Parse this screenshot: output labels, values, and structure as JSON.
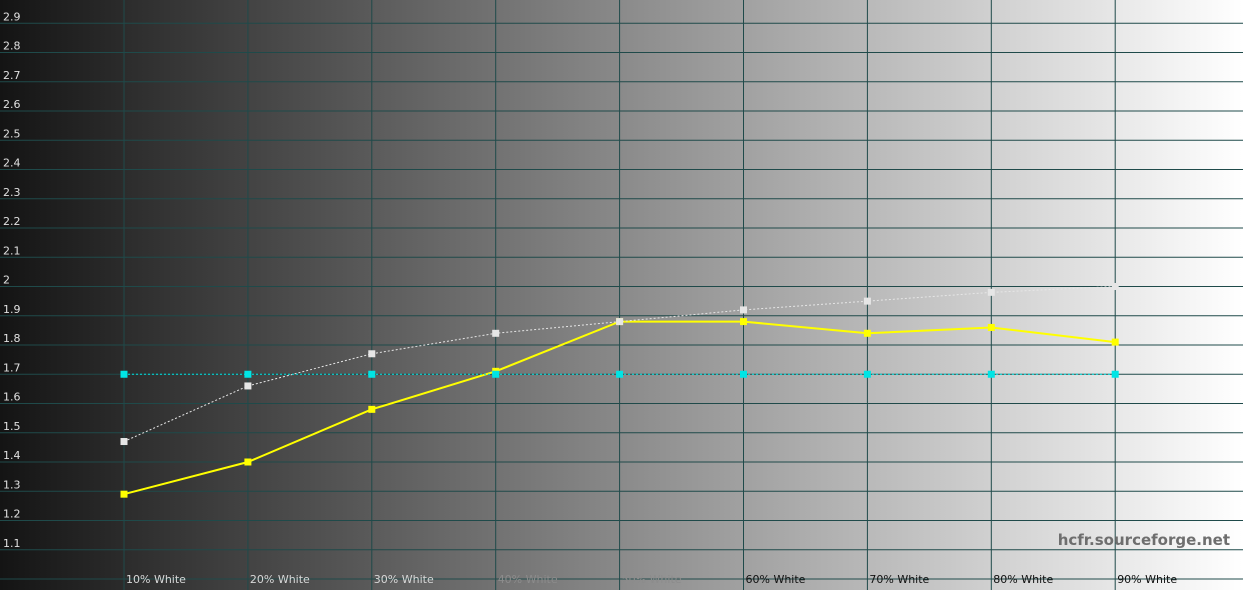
{
  "chart_data": {
    "type": "line",
    "categories": [
      "10% White",
      "20% White",
      "30% White",
      "40% White",
      "50% White",
      "60% White",
      "70% White",
      "80% White",
      "90% White"
    ],
    "yticks": [
      "1.1",
      "1.2",
      "1.3",
      "1.4",
      "1.5",
      "1.6",
      "1.7",
      "1.8",
      "1.9",
      "2",
      "2.1",
      "2.2",
      "2.3",
      "2.4",
      "2.5",
      "2.6",
      "2.7",
      "2.8",
      "2.9"
    ],
    "ylim": [
      1.0,
      3.0
    ],
    "grid": true,
    "series": [
      {
        "values": [
          1.29,
          1.4,
          1.58,
          1.71,
          1.88,
          1.88,
          1.84,
          1.86,
          1.81
        ],
        "color": "#ffff00",
        "style": "solid"
      },
      {
        "values": [
          1.47,
          1.66,
          1.77,
          1.84,
          1.88,
          1.92,
          1.95,
          1.98,
          2.0
        ],
        "color": "#e6e6e6",
        "style": "dotted"
      },
      {
        "values": [
          1.7,
          1.7,
          1.7,
          1.7,
          1.7,
          1.7,
          1.7,
          1.7,
          1.7
        ],
        "color": "#00e5e5",
        "style": "dotted"
      }
    ]
  },
  "watermark": "hcfr.sourceforge.net"
}
